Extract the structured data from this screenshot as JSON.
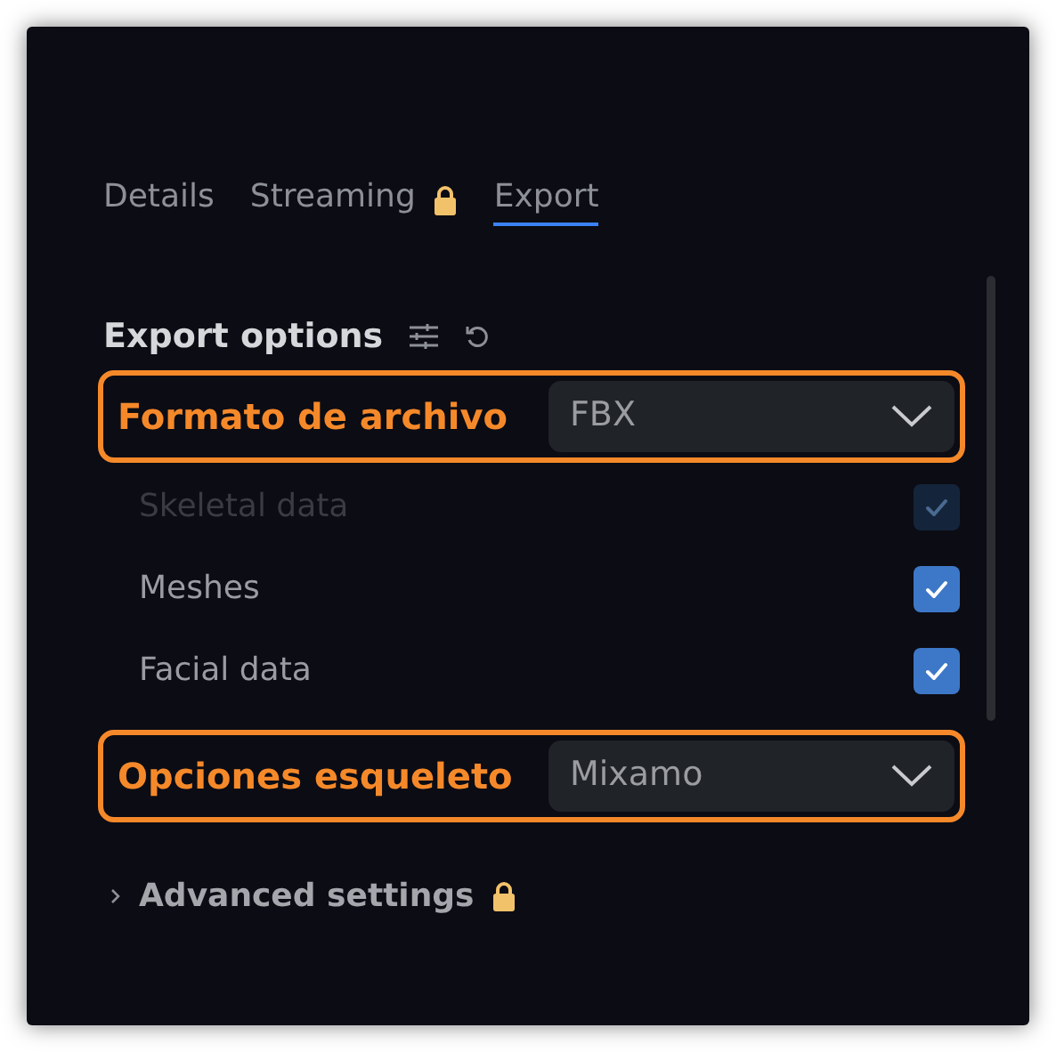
{
  "tabs": [
    {
      "label": "Details",
      "selected": false,
      "locked": false
    },
    {
      "label": "Streaming",
      "selected": false,
      "locked": true
    },
    {
      "label": "Export",
      "selected": true,
      "locked": false
    }
  ],
  "export_options": {
    "title": "Export options",
    "fields": [
      {
        "label": "Formato de archivo",
        "value": "FBX",
        "highlighted": true
      }
    ],
    "checkboxes": [
      {
        "label": "Skeletal data",
        "checked": true,
        "disabled": true
      },
      {
        "label": "Meshes",
        "checked": true,
        "disabled": false
      },
      {
        "label": "Facial data",
        "checked": true,
        "disabled": false
      }
    ],
    "fields_after": [
      {
        "label": "Opciones esqueleto",
        "value": "Mixamo",
        "highlighted": true
      }
    ]
  },
  "advanced": {
    "label": "Advanced settings",
    "expanded": false,
    "locked": true
  }
}
